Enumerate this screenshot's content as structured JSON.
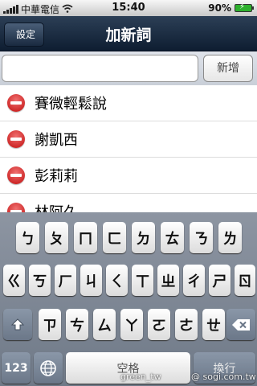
{
  "status_bar": {
    "carrier": "中華電信",
    "time": "15:40",
    "battery": "90%"
  },
  "nav": {
    "back_label": "設定",
    "title": "加新詞"
  },
  "entry": {
    "value": "",
    "placeholder": "",
    "add_label": "新增"
  },
  "words": [
    {
      "label": "賽微輕鬆說"
    },
    {
      "label": "謝凱西"
    },
    {
      "label": "彭莉莉"
    },
    {
      "label": "林阿久"
    }
  ],
  "keyboard": {
    "row1": [
      "ㄅ",
      "ㄆ",
      "ㄇ",
      "ㄈ",
      "ㄉ",
      "ㄊ",
      "ㄋ",
      "ㄌ"
    ],
    "row2": [
      "ㄍ",
      "ㄎ",
      "ㄏ",
      "ㄐ",
      "ㄑ",
      "ㄒ",
      "ㄓ",
      "ㄔ",
      "ㄕ",
      "ㄖ"
    ],
    "row3": [
      "ㄗ",
      "ㄘ",
      "ㄙ",
      "ㄚ",
      "ㄛ",
      "ㄜ",
      "ㄝ"
    ],
    "numbers_label": "123",
    "space_label": "空格",
    "return_label": "換行"
  },
  "watermark": {
    "left": "green_tw",
    "right": "@ sogi.com.tw"
  },
  "colors": {
    "nav_bar": "#1a2a40",
    "delete_red": "#d01818",
    "battery_green": "#2db02d"
  }
}
